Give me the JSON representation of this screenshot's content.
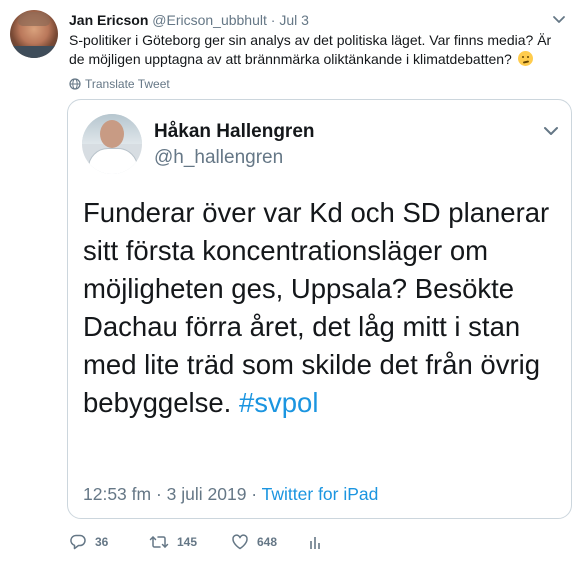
{
  "tweet": {
    "author_name": "Jan Ericson",
    "author_handle": "@Ericson_ubbhult",
    "separator": "·",
    "date": "Jul 3",
    "text": "S-politiker i Göteborg ger sin analys av det politiska läget. Var finns media? Är de möjligen upptagna av att brännmärka oliktänkande i klimatdebatten?",
    "emoji_icon": "thinking-face-icon",
    "translate_label": "Translate Tweet"
  },
  "quoted": {
    "author_name": "Håkan Hallengren",
    "author_handle": "@h_hallengren",
    "text": "Funderar över var Kd och SD planerar sitt första koncentrationsläger om möjligheten ges, Uppsala? Besökte Dachau förra året, det låg mitt i stan med lite träd som skilde det från övrig bebyggelse.",
    "hashtag": "#svpol",
    "timestamp": "12:53 fm · 3 juli 2019 · ",
    "source": "Twitter for iPad"
  },
  "actions": {
    "replies": "36",
    "retweets": "145",
    "likes": "648"
  },
  "colors": {
    "text": "#14171a",
    "secondary": "#657786",
    "link": "#1b95e0",
    "border": "#ccd6dd"
  }
}
